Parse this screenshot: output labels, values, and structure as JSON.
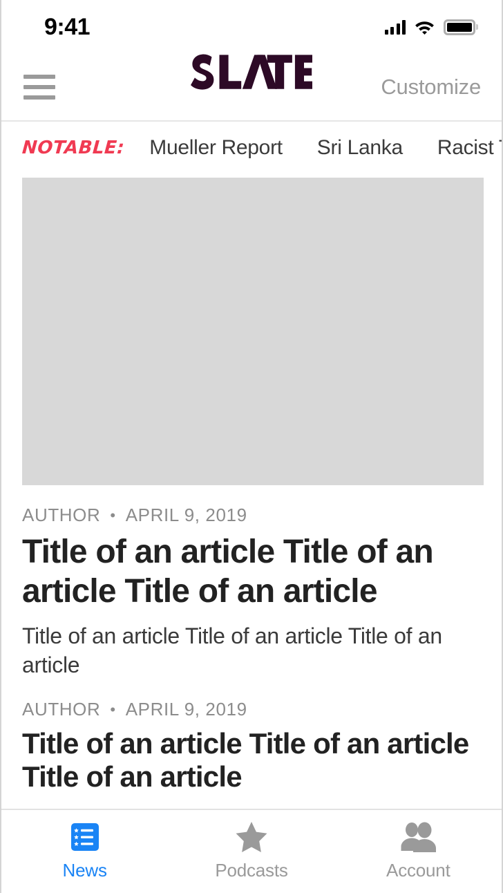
{
  "status_bar": {
    "time": "9:41",
    "signal_icon": "cellular-signal-icon",
    "wifi_icon": "wifi-icon",
    "battery_icon": "battery-full-icon"
  },
  "header": {
    "menu_icon": "hamburger-menu-icon",
    "brand": "SLATE",
    "brand_color": "#2d0a26",
    "customize_label": "Customize"
  },
  "notable": {
    "label": "NOTABLE:",
    "label_color": "#f03a52",
    "topics": [
      {
        "label": "Mueller Report"
      },
      {
        "label": "Sri Lanka"
      },
      {
        "label": "Racist Trolls"
      }
    ]
  },
  "feed": {
    "articles": [
      {
        "has_image": true,
        "image_placeholder_color": "#d8d8d8",
        "author": "AUTHOR",
        "separator": "•",
        "date": "APRIL 9, 2019",
        "title": "Title of an article Title of an article Title of an article",
        "dek": "Title of an article Title of an article Title of an article"
      },
      {
        "has_image": false,
        "author": "AUTHOR",
        "separator": "•",
        "date": "APRIL 9, 2019",
        "title": "Title of an article Title of an article Title of an article"
      }
    ]
  },
  "tab_bar": {
    "active_color": "#1a84f5",
    "inactive_color": "#9a9a9a",
    "tabs": [
      {
        "label": "News",
        "icon": "news-list-icon",
        "active": true
      },
      {
        "label": "Podcasts",
        "icon": "star-icon",
        "active": false
      },
      {
        "label": "Account",
        "icon": "people-icon",
        "active": false
      }
    ]
  }
}
